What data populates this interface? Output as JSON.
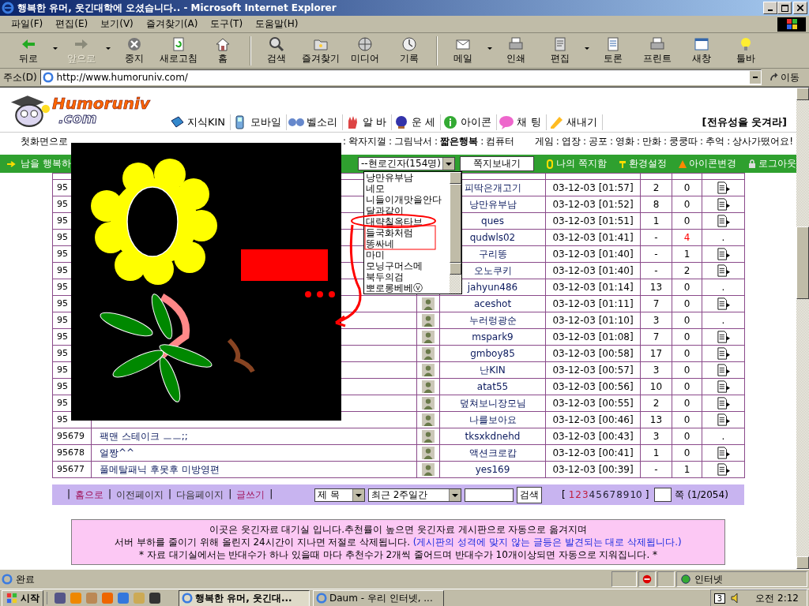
{
  "window": {
    "title": "행복한 유머, 웃긴대학에 오셨습니다.. - Microsoft Internet Explorer"
  },
  "menu": [
    "파일(F)",
    "편집(E)",
    "보기(V)",
    "즐겨찾기(A)",
    "도구(T)",
    "도움말(H)"
  ],
  "toolbar": [
    {
      "label": "뒤로",
      "kind": "back",
      "disabled": false,
      "dropdown": true,
      "separator_before": false
    },
    {
      "label": "앞으로",
      "kind": "forward",
      "disabled": true,
      "dropdown": true,
      "separator_before": false
    },
    {
      "label": "중지",
      "kind": "stop",
      "disabled": false,
      "dropdown": false,
      "separator_before": false
    },
    {
      "label": "새로고침",
      "kind": "refresh",
      "disabled": false,
      "dropdown": false,
      "separator_before": false
    },
    {
      "label": "홈",
      "kind": "home",
      "disabled": false,
      "dropdown": false,
      "separator_before": false
    },
    {
      "label": "검색",
      "kind": "search",
      "disabled": false,
      "dropdown": false,
      "separator_before": true
    },
    {
      "label": "즐겨찾기",
      "kind": "favorites",
      "disabled": false,
      "dropdown": false,
      "separator_before": false
    },
    {
      "label": "미디어",
      "kind": "media",
      "disabled": false,
      "dropdown": false,
      "separator_before": false
    },
    {
      "label": "기록",
      "kind": "history",
      "disabled": false,
      "dropdown": false,
      "separator_before": false
    },
    {
      "label": "메일",
      "kind": "mail",
      "disabled": false,
      "dropdown": true,
      "separator_before": true
    },
    {
      "label": "인쇄",
      "kind": "print",
      "disabled": false,
      "dropdown": false,
      "separator_before": false
    },
    {
      "label": "편집",
      "kind": "edit",
      "disabled": false,
      "dropdown": true,
      "separator_before": false
    },
    {
      "label": "토론",
      "kind": "discuss",
      "disabled": false,
      "dropdown": false,
      "separator_before": false
    },
    {
      "label": "프린트",
      "kind": "print",
      "disabled": false,
      "dropdown": false,
      "separator_before": false
    },
    {
      "label": "새창",
      "kind": "window",
      "disabled": false,
      "dropdown": false,
      "separator_before": false
    },
    {
      "label": "툴바",
      "kind": "bulb",
      "disabled": false,
      "dropdown": false,
      "separator_before": false
    }
  ],
  "address": {
    "label": "주소(D)",
    "value": "http://www.humoruniv.com/",
    "go": "이동"
  },
  "site": {
    "logo": [
      "Humoruniv",
      ".com"
    ],
    "nav": [
      {
        "label": "지식KIN",
        "kind": "book"
      },
      {
        "label": "모바일",
        "kind": "phone"
      },
      {
        "label": "벨소리",
        "kind": "notes"
      },
      {
        "label": "알 바",
        "kind": "hand"
      },
      {
        "label": "운 세",
        "kind": "ball"
      },
      {
        "label": "아이콘",
        "kind": "info"
      },
      {
        "label": "채 팅",
        "kind": "chat"
      },
      {
        "label": "새내기",
        "kind": "pencil"
      }
    ],
    "slogan": "[전유성을 웃겨라]",
    "categories_left": [
      {
        "label": "첫화면으로",
        "bold": false
      },
      {
        "label": "왁자지껄",
        "bold": false
      },
      {
        "label": "그림낙서",
        "bold": false
      },
      {
        "label": "짧은행복",
        "bold": true
      },
      {
        "label": "컴퓨터",
        "bold": false
      }
    ],
    "categories_right": [
      "게임",
      "엽장",
      "공포",
      "영화",
      "만화",
      "쿵쿵따",
      "추억",
      "상사가떴어요!"
    ],
    "separator": ":"
  },
  "userbar": {
    "greeting": "남을 행복하",
    "online_select": "--현로긴자(154명)",
    "send_button": "쪽지보내기",
    "links": [
      {
        "label": "나의 쪽지함",
        "kind": "clip"
      },
      {
        "label": "환경설정",
        "kind": "tool"
      },
      {
        "label": "아이콘변경",
        "kind": "cone"
      },
      {
        "label": "로그아웃",
        "kind": "lock"
      }
    ]
  },
  "online_list": [
    "낭만유부남",
    "네모",
    "니들이개맛을안다",
    "달과같이",
    "대략칠옥타브",
    "들국화처럼",
    "똥싸네",
    "마미",
    "모닝구머스메",
    "북두의검",
    "뽀로롱베베ⓥ"
  ],
  "table": {
    "rows": [
      {
        "number": "95",
        "author": "피딱은개고기",
        "date": "03-12-03 [01:57]",
        "recommend": "2",
        "oppose": "0",
        "alert": false,
        "status": {
          "kind": "memo"
        }
      },
      {
        "number": "95",
        "author": "낭만유부남",
        "date": "03-12-03 [01:52]",
        "recommend": "8",
        "oppose": "0",
        "alert": false,
        "status": {
          "kind": "memo"
        }
      },
      {
        "number": "95",
        "author": "ques",
        "date": "03-12-03 [01:51]",
        "recommend": "1",
        "oppose": "0",
        "alert": false,
        "status": {
          "kind": "memo"
        }
      },
      {
        "number": "95",
        "author": "qudwls02",
        "date": "03-12-03 [01:41]",
        "recommend": "-",
        "oppose": "4",
        "alert": true,
        "status": {
          "kind": "dot",
          "text": "."
        }
      },
      {
        "number": "95",
        "author": "구리똥",
        "date": "03-12-03 [01:40]",
        "recommend": "-",
        "oppose": "1",
        "alert": false,
        "status": {
          "kind": "memo"
        }
      },
      {
        "number": "95",
        "author": "오노쿠키",
        "date": "03-12-03 [01:40]",
        "recommend": "-",
        "oppose": "2",
        "alert": false,
        "status": {
          "kind": "memo"
        }
      },
      {
        "number": "95",
        "author": "jahyun486",
        "date": "03-12-03 [01:14]",
        "recommend": "13",
        "oppose": "0",
        "alert": false,
        "status": {
          "kind": "dot",
          "text": "."
        }
      },
      {
        "number": "95",
        "author": "aceshot",
        "date": "03-12-03 [01:11]",
        "recommend": "7",
        "oppose": "0",
        "alert": false,
        "status": {
          "kind": "memo"
        }
      },
      {
        "number": "95",
        "author": "누러렁광순",
        "date": "03-12-03 [01:10]",
        "recommend": "3",
        "oppose": "0",
        "alert": false,
        "status": {
          "kind": "dot",
          "text": "."
        }
      },
      {
        "number": "95",
        "author": "mspark9",
        "date": "03-12-03 [01:08]",
        "recommend": "7",
        "oppose": "0",
        "alert": false,
        "status": {
          "kind": "memo"
        }
      },
      {
        "number": "95",
        "author": "gmboy85",
        "date": "03-12-03 [00:58]",
        "recommend": "17",
        "oppose": "0",
        "alert": false,
        "status": {
          "kind": "memo"
        }
      },
      {
        "number": "95",
        "author": "난KIN",
        "date": "03-12-03 [00:57]",
        "recommend": "3",
        "oppose": "0",
        "alert": false,
        "status": {
          "kind": "memo"
        }
      },
      {
        "number": "95",
        "author": "atat55",
        "date": "03-12-03 [00:56]",
        "recommend": "10",
        "oppose": "0",
        "alert": false,
        "status": {
          "kind": "memo"
        }
      },
      {
        "number": "95",
        "author": "덮쳐보니장모님",
        "date": "03-12-03 [00:55]",
        "recommend": "2",
        "oppose": "0",
        "alert": false,
        "status": {
          "kind": "memo"
        }
      },
      {
        "number": "95",
        "author": "나를보아요",
        "date": "03-12-03 [00:46]",
        "recommend": "13",
        "oppose": "0",
        "alert": false,
        "status": {
          "kind": "memo"
        }
      },
      {
        "number": "95679",
        "title": "팩맨 스테이크 ㅡㅡ;;",
        "author": "tksxkdnehd",
        "date": "03-12-03 [00:43]",
        "recommend": "3",
        "oppose": "0",
        "alert": false,
        "status": {
          "kind": "dot",
          "text": "."
        }
      },
      {
        "number": "95678",
        "title": "얼짱^^",
        "author": "액션크로캅",
        "date": "03-12-03 [00:41]",
        "recommend": "1",
        "oppose": "0",
        "alert": false,
        "status": {
          "kind": "memo"
        }
      },
      {
        "number": "95677",
        "title": "풀메탈패닉 후못후 미방영편",
        "author": "yes169",
        "date": "03-12-03 [00:39]",
        "recommend": "-",
        "oppose": "1",
        "alert": false,
        "status": {
          "kind": "memo"
        }
      }
    ]
  },
  "board_nav": {
    "separator": "|",
    "links": [
      {
        "label": "홈으로",
        "visited": true
      },
      {
        "label": "이전페이지",
        "visited": false
      },
      {
        "label": "다음페이지",
        "visited": false
      },
      {
        "label": "글쓰기",
        "visited": true
      }
    ],
    "field_select": "제 목",
    "period_select": "최근 2주일간",
    "search_button": "검색",
    "open_bracket": "[",
    "close_bracket": "]",
    "pages": [
      {
        "label": "1",
        "visited": true
      },
      {
        "label": "2",
        "visited": true
      },
      {
        "label": "3",
        "visited": true
      },
      {
        "label": "4",
        "visited": false
      },
      {
        "label": "5",
        "visited": false
      },
      {
        "label": "6",
        "visited": false
      },
      {
        "label": "7",
        "visited": false
      },
      {
        "label": "8",
        "visited": false
      },
      {
        "label": "9",
        "visited": false
      },
      {
        "label": "10",
        "visited": false
      }
    ],
    "page_suffix": "쪽 (1/2054)"
  },
  "notice": {
    "lines": [
      [
        {
          "kind": "plain",
          "text": "이곳은 웃긴자료 대기실 입니다.추천률이 높으면 웃긴자료 게시판으로 자동으로 옮겨지며"
        }
      ],
      [
        {
          "kind": "plain",
          "text": "서버 부하를 줄이기 위해 올린지 24시간이 지나면 저절로 삭제됩니다. "
        },
        {
          "kind": "highlight",
          "text": "(게시판의 성격에 맞지 않는 글등은 발견되는 대로 삭제됩니다.)"
        }
      ],
      [
        {
          "kind": "plain",
          "text": "* 자료 대기실에서는 반대수가 하나 있을때 마다 추천수가 2개씩 줄어드며 반대수가 10개이상되면 자동으로 지워집니다. *"
        }
      ]
    ]
  },
  "status_bar": {
    "text": "완료",
    "zone": "인터넷"
  },
  "taskbar": {
    "start": "시작",
    "tasks": [
      {
        "label": "행복한 유머, 웃긴대...",
        "selected": true
      },
      {
        "label": "Daum - 우리 인터넷, ...",
        "selected": false
      }
    ],
    "tray_badge": "3",
    "clock": "오전 2:12"
  }
}
